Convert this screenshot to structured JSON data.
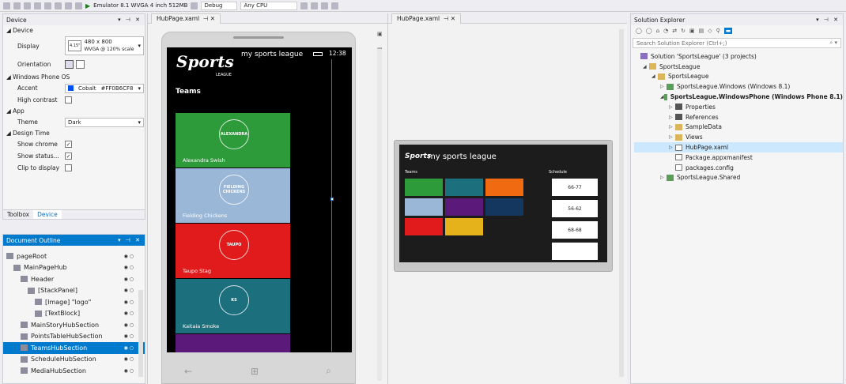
{
  "toolbar": {
    "emulator": "Emulator 8.1 WVGA 4 inch 512MB",
    "config": "Debug",
    "platform": "Any CPU"
  },
  "device_panel": {
    "title": "Device",
    "section_device": "Device",
    "display_label": "Display",
    "display_res": "480 x 800",
    "display_detail": "WVGA @ 120% scale",
    "display_size": "4.15\"",
    "orientation_label": "Orientation",
    "section_os": "Windows Phone OS",
    "accent_label": "Accent",
    "accent_value": "Cobalt",
    "accent_hex": "#FF0B6CF8",
    "accent_color": "#0050ef",
    "high_contrast_label": "High contrast",
    "section_app": "App",
    "theme_label": "Theme",
    "theme_value": "Dark",
    "section_design": "Design Time",
    "show_chrome_label": "Show chrome",
    "show_status_label": "Show status...",
    "clip_label": "Clip to display",
    "tab_toolbox": "Toolbox",
    "tab_device": "Device"
  },
  "outline": {
    "title": "Document Outline",
    "items": [
      {
        "label": "pageRoot",
        "indent": 0
      },
      {
        "label": "MainPageHub",
        "indent": 1
      },
      {
        "label": "Header",
        "indent": 2
      },
      {
        "label": "[StackPanel]",
        "indent": 3
      },
      {
        "label": "[Image] \"logo\"",
        "indent": 4
      },
      {
        "label": "[TextBlock]",
        "indent": 4
      },
      {
        "label": "MainStoryHubSection",
        "indent": 2
      },
      {
        "label": "PointsTableHubSection",
        "indent": 2
      },
      {
        "label": "TeamsHubSection",
        "indent": 2
      },
      {
        "label": "ScheduleHubSection",
        "indent": 2
      },
      {
        "label": "MediaHubSection",
        "indent": 2
      }
    ]
  },
  "doc_tabs": {
    "left": "HubPage.xaml",
    "right": "HubPage.xaml"
  },
  "phone": {
    "app_title": "my sports league",
    "time": "12:38",
    "logo_text": "Sports",
    "logo_sub": "LEAGUE",
    "section": "Teams",
    "teams": [
      {
        "name": "Alexandra Swish",
        "badge": "ALEXANDRA",
        "color": "#2e9b3a"
      },
      {
        "name": "Fielding Chickens",
        "badge": "FIELDING CHICKENS",
        "color": "#9ab7d7"
      },
      {
        "name": "Taupo Stag",
        "badge": "TAUPO",
        "color": "#e11b1b"
      },
      {
        "name": "Kaitaia Smoke",
        "badge": "KS",
        "color": "#1c6f7c"
      },
      {
        "name": "",
        "badge": "",
        "color": "#5b1a7a"
      }
    ]
  },
  "tablet": {
    "app_title": "my sports league",
    "teams_label": "Teams",
    "schedule_label": "Schedule",
    "tile_colors": [
      "#2e9b3a",
      "#1c6f7c",
      "#f06a12",
      "#9ab7d7",
      "#5b1a7a",
      "#13375f",
      "#e11b1b",
      "#e6b21c"
    ],
    "scores": [
      "66-77",
      "56-62",
      "68-68",
      ""
    ]
  },
  "solution": {
    "title": "Solution Explorer",
    "search_placeholder": "Search Solution Explorer (Ctrl+;)",
    "items": [
      {
        "label": "Solution 'SportsLeague' (3 projects)",
        "indent": 0,
        "icon": "sol",
        "arrow": ""
      },
      {
        "label": "SportsLeague",
        "indent": 1,
        "icon": "folder",
        "arrow": "◢"
      },
      {
        "label": "SportsLeague",
        "indent": 2,
        "icon": "folder",
        "arrow": "◢"
      },
      {
        "label": "SportsLeague.Windows (Windows 8.1)",
        "indent": 3,
        "icon": "proj",
        "arrow": "▷"
      },
      {
        "label": "SportsLeague.WindowsPhone (Windows Phone 8.1)",
        "indent": 3,
        "icon": "proj",
        "arrow": "◢"
      },
      {
        "label": "Properties",
        "indent": 4,
        "icon": "ref",
        "arrow": "▷"
      },
      {
        "label": "References",
        "indent": 4,
        "icon": "ref",
        "arrow": "▷"
      },
      {
        "label": "SampleData",
        "indent": 4,
        "icon": "folder",
        "arrow": "▷"
      },
      {
        "label": "Views",
        "indent": 4,
        "icon": "folder",
        "arrow": "▷"
      },
      {
        "label": "HubPage.xaml",
        "indent": 4,
        "icon": "file",
        "arrow": "▷"
      },
      {
        "label": "Package.appxmanifest",
        "indent": 4,
        "icon": "file",
        "arrow": ""
      },
      {
        "label": "packages.config",
        "indent": 4,
        "icon": "file",
        "arrow": ""
      },
      {
        "label": "SportsLeague.Shared",
        "indent": 3,
        "icon": "proj",
        "arrow": "▷"
      }
    ]
  }
}
